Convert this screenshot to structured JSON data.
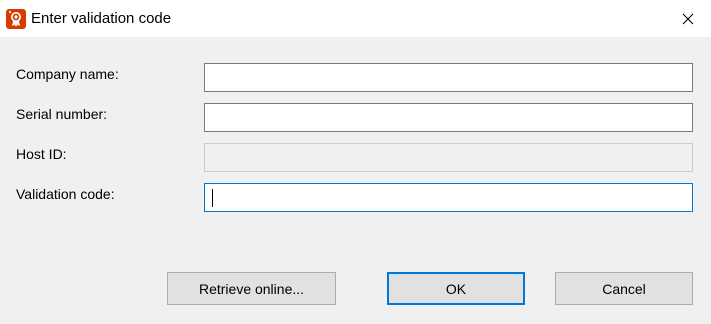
{
  "window": {
    "title": "Enter validation code",
    "icon": "certificate-icon",
    "close_icon": "close-icon"
  },
  "form": {
    "company_name": {
      "label": "Company name:",
      "value": ""
    },
    "serial_number": {
      "label": "Serial number:",
      "value": ""
    },
    "host_id": {
      "label": "Host ID:",
      "value": ""
    },
    "validation_code": {
      "label": "Validation code:",
      "value": ""
    }
  },
  "buttons": {
    "retrieve_online": "Retrieve online...",
    "ok": "OK",
    "cancel": "Cancel"
  },
  "colors": {
    "accent": "#0078d7",
    "app_icon": "#d83b01"
  }
}
